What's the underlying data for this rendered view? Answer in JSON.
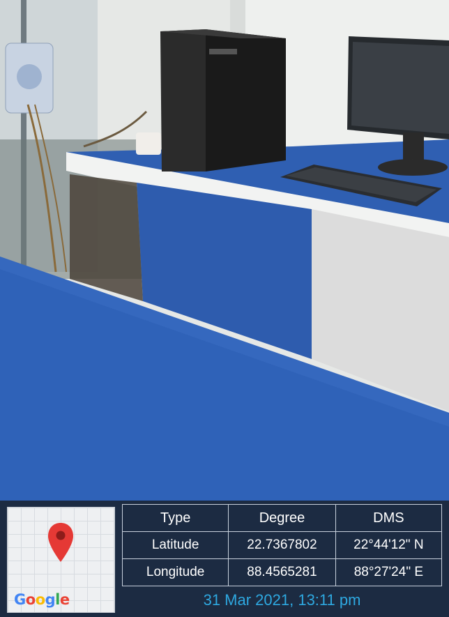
{
  "photo": {
    "scene": "office-desk-with-computer"
  },
  "map": {
    "pin_color": "#e53935",
    "logo_letters": [
      "G",
      "o",
      "o",
      "g",
      "l",
      "e"
    ]
  },
  "table": {
    "headers": [
      "Type",
      "Degree",
      "DMS"
    ],
    "rows": [
      {
        "type": "Latitude",
        "degree": "22.7367802",
        "dms": "22°44'12\" N"
      },
      {
        "type": "Longitude",
        "degree": "88.4565281",
        "dms": "88°27'24\" E"
      }
    ]
  },
  "timestamp": "31 Mar 2021, 13:11 pm",
  "colors": {
    "overlay_bg": "#1c2b42",
    "timestamp": "#2ea8e0",
    "desk_blue": "#2f5fb2"
  }
}
